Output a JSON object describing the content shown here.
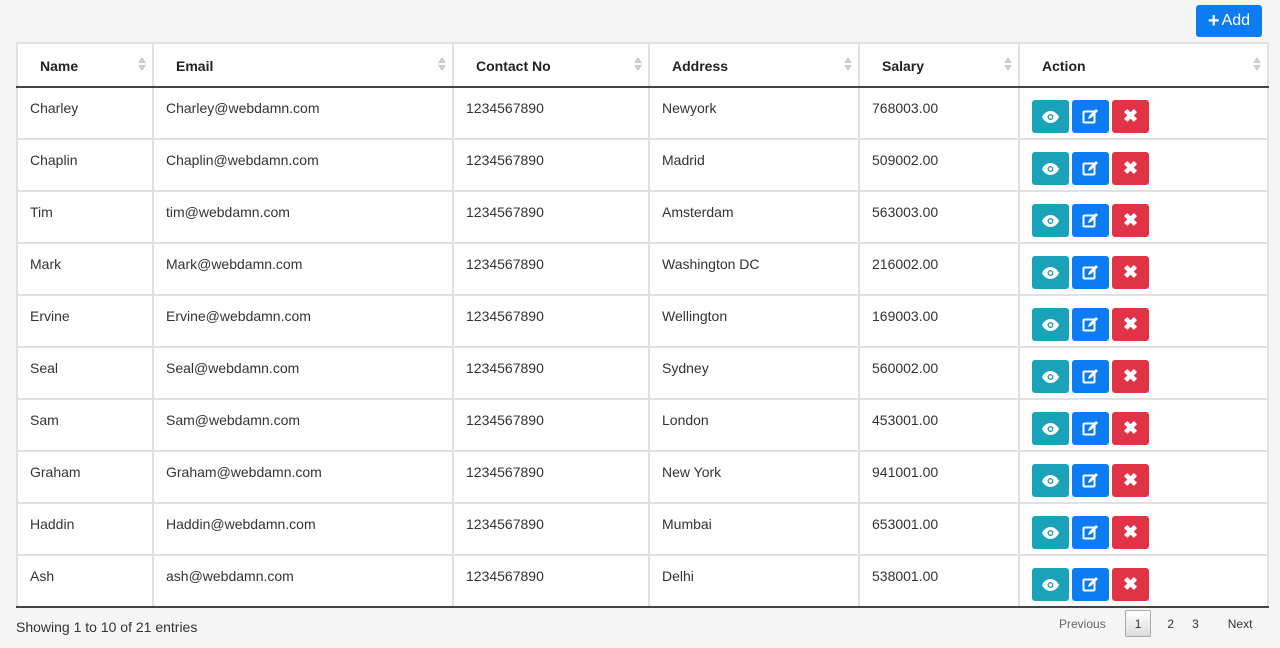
{
  "toolbar": {
    "add_label": "Add",
    "add_icon": "plus-icon"
  },
  "table": {
    "columns": [
      "Name",
      "Email",
      "Contact No",
      "Address",
      "Salary",
      "Action"
    ],
    "rows": [
      [
        "Charley",
        "Charley@webdamn.com",
        "1234567890",
        "Newyork",
        "768003.00"
      ],
      [
        "Chaplin",
        "Chaplin@webdamn.com",
        "1234567890",
        "Madrid",
        "509002.00"
      ],
      [
        "Tim",
        "tim@webdamn.com",
        "1234567890",
        "Amsterdam",
        "563003.00"
      ],
      [
        "Mark",
        "Mark@webdamn.com",
        "1234567890",
        "Washington DC",
        "216002.00"
      ],
      [
        "Ervine",
        "Ervine@webdamn.com",
        "1234567890",
        "Wellington",
        "169003.00"
      ],
      [
        "Seal",
        "Seal@webdamn.com",
        "1234567890",
        "Sydney",
        "560002.00"
      ],
      [
        "Sam",
        "Sam@webdamn.com",
        "1234567890",
        "London",
        "453001.00"
      ],
      [
        "Graham",
        "Graham@webdamn.com",
        "1234567890",
        "New York",
        "941001.00"
      ],
      [
        "Haddin",
        "Haddin@webdamn.com",
        "1234567890",
        "Mumbai",
        "653001.00"
      ],
      [
        "Ash",
        "ash@webdamn.com",
        "1234567890",
        "Delhi",
        "538001.00"
      ]
    ],
    "row_actions": [
      "eye-icon",
      "edit-icon",
      "close-icon"
    ]
  },
  "footer": {
    "info": "Showing 1 to 10 of 21 entries",
    "pagination": {
      "previous": "Previous",
      "pages": [
        "1",
        "2",
        "3"
      ],
      "current": "1",
      "next": "Next"
    }
  },
  "colors": {
    "primary": "#0d7bf2",
    "info": "#19a2b8",
    "danger": "#e03446"
  }
}
